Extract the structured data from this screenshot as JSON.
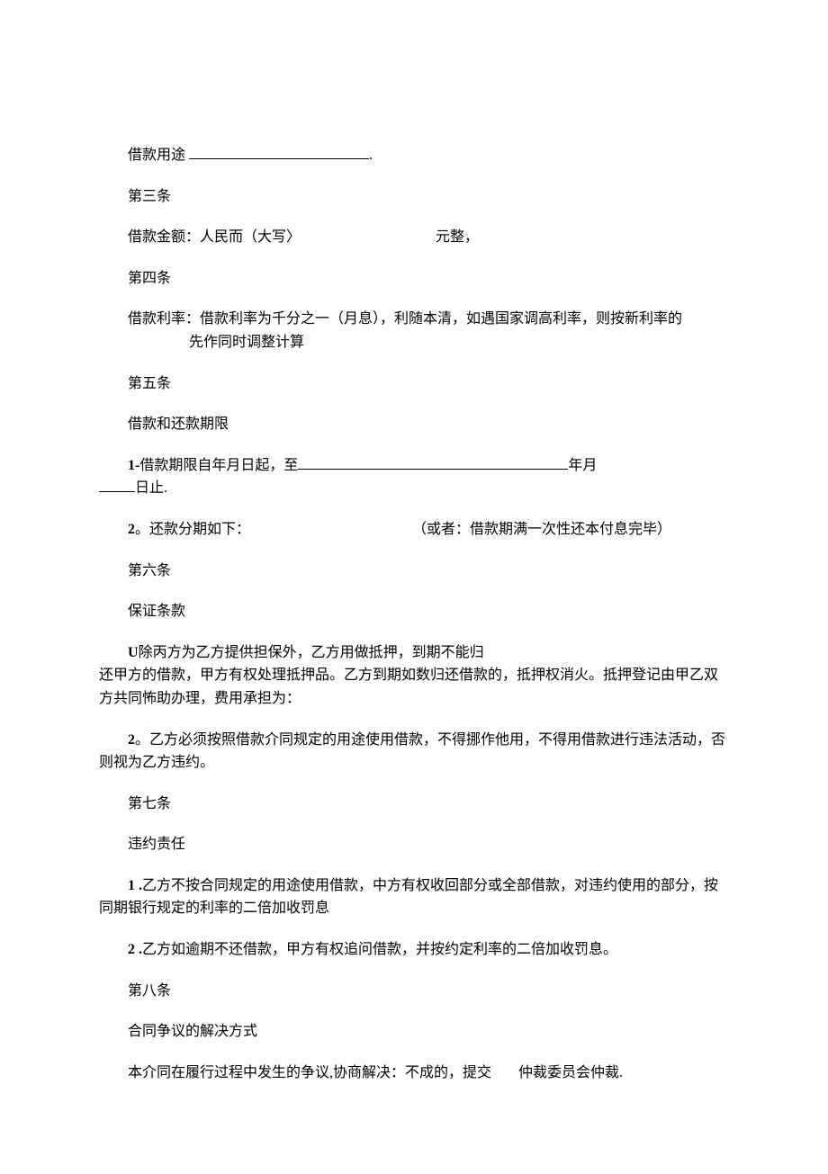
{
  "p1_label": "借款用途",
  "p1_period": ".",
  "p2": "第三条",
  "p3_part1": "借款金额：人民而（大写〉",
  "p3_part2": "元整，",
  "p4": "第四条",
  "p5_line1": "借款利率：借款利率为千分之一（月息），利随本清，如遇国家调高利率，则按新利率的",
  "p5_line2": "先作同时调整计算",
  "p6": "第五条",
  "p7": "借款和还款期限",
  "p8_part1": "1-",
  "p8_part2": "借款期限自年月日起，至",
  "p8_part3": "年月",
  "p8_part4": "日止.",
  "p9_part1": "2",
  "p9_part2": "。还款分期如下：",
  "p9_part3": "（或者：借款期满一次性还本付息完毕）",
  "p10": "第六条",
  "p11": "保证条款",
  "p12_part1": "U",
  "p12_part2": "除丙方为乙方提供担保外，乙方用做抵押，到期不能归",
  "p12_line2": "还甲方的借款，甲方有权处理抵押品。乙方到期如数归还借款的，抵押权消火。抵押登记由甲乙双方共同怖助办理，费用承担为：",
  "p13_part1": "2",
  "p13_part2": "。乙方必须按照借款介同规定的用途使用借款，不得挪作他用，不得用借款进行违法活动，否则视为乙方违约。",
  "p14": "第七条",
  "p15": "违约责任",
  "p16_part1": "1 .",
  "p16_part2": "乙方不按合同规定的用途使用借款，中方有权收回部分或全部借款，对违约使用的部分，按同期银行规定的利率的二倍加收罚息",
  "p17_part1": "2 .",
  "p17_part2": "乙方如逾期不还借款，甲方有权追问借款，并按约定利率的二倍加收罚息。",
  "p18": "第八条",
  "p19": "合同争议的解决方式",
  "p20_part1": "本介同在履行过程中发生的争议,协商解决：不成的，提交",
  "p20_part2": "仲裁委员会仲裁."
}
